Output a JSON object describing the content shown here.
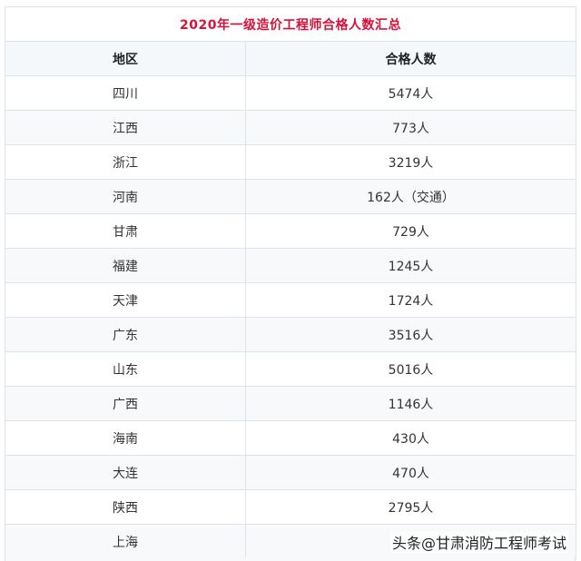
{
  "table": {
    "title": "2020年一级造价工程师合格人数汇总",
    "headers": [
      "地区",
      "合格人数"
    ],
    "rows": [
      {
        "region": "四川",
        "count": "5474人"
      },
      {
        "region": "江西",
        "count": "773人"
      },
      {
        "region": "浙江",
        "count": "3219人"
      },
      {
        "region": "河南",
        "count": "162人（交通）"
      },
      {
        "region": "甘肃",
        "count": "729人"
      },
      {
        "region": "福建",
        "count": "1245人"
      },
      {
        "region": "天津",
        "count": "1724人"
      },
      {
        "region": "广东",
        "count": "3516人"
      },
      {
        "region": "山东",
        "count": "5016人"
      },
      {
        "region": "广西",
        "count": "1146人"
      },
      {
        "region": "海南",
        "count": "430人"
      },
      {
        "region": "大连",
        "count": "470人"
      },
      {
        "region": "陕西",
        "count": "2795人"
      },
      {
        "region": "上海",
        "count": ""
      }
    ]
  },
  "watermark": "头条@甘肃消防工程师考试"
}
